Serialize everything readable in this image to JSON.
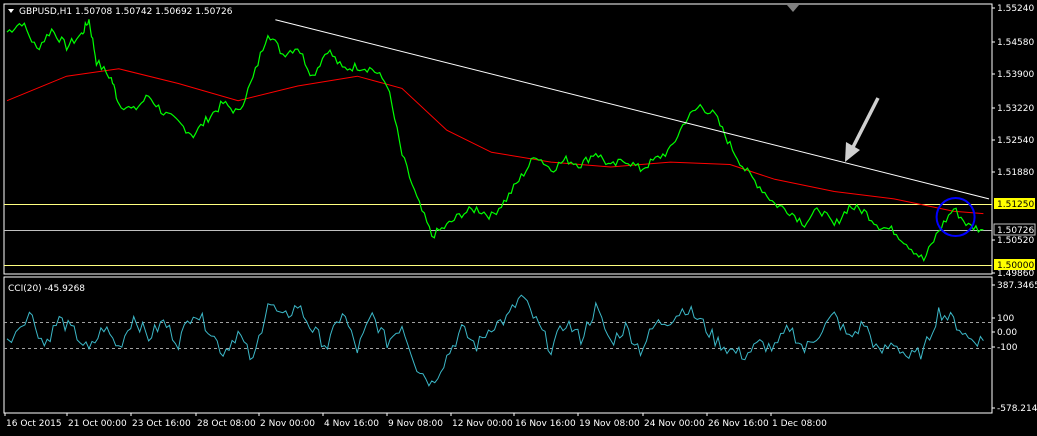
{
  "header": {
    "symbol": "GBPUSD,H1",
    "ohlc": "1.50708 1.50742 1.50692 1.50726"
  },
  "indicator_header": {
    "label": "CCI(20) -45.9268"
  },
  "colors": {
    "background": "#000000",
    "price_line": "#00ff00",
    "moving_average": "#ff0000",
    "trendline": "#ffffff",
    "horizontal_level": "#ffff80",
    "current_price_line": "#c0c0c0",
    "highlight_circle": "#0000ff",
    "cci_line": "#3cb8c8",
    "cci_level_line": "#a0a0a0",
    "frame": "#ffffff",
    "label_yellow_bg": "#ffff00"
  },
  "icons": [
    "dropdown-triangle-icon",
    "arrow-down-left-icon",
    "scroll-marker-icon"
  ],
  "chart_data": [
    {
      "type": "line",
      "panel": "price",
      "x_labels": [
        "16 Oct 2015",
        "21 Oct 00:00",
        "23 Oct 16:00",
        "28 Oct 08:00",
        "2 Nov 00:00",
        "4 Nov 16:00",
        "9 Nov 08:00",
        "12 Nov 00:00",
        "16 Nov 16:00",
        "19 Nov 08:00",
        "24 Nov 00:00",
        "26 Nov 16:00",
        "1 Dec 08:00"
      ],
      "y_ticks": [
        "1.55240",
        "1.54580",
        "1.53900",
        "1.53220",
        "1.52540",
        "1.51880",
        "1.50520",
        "1.49860"
      ],
      "ylim": [
        1.4982,
        1.5532
      ],
      "grid": false,
      "price_path": [
        [
          0,
          1.5475
        ],
        [
          2,
          1.5495
        ],
        [
          4,
          1.544
        ],
        [
          6,
          1.548
        ],
        [
          8,
          1.5445
        ],
        [
          10,
          1.547
        ],
        [
          11,
          1.55
        ],
        [
          12,
          1.5415
        ],
        [
          14,
          1.538
        ],
        [
          15,
          1.533
        ],
        [
          17,
          1.5315
        ],
        [
          19,
          1.5345
        ],
        [
          21,
          1.531
        ],
        [
          23,
          1.529
        ],
        [
          25,
          1.5265
        ],
        [
          27,
          1.53
        ],
        [
          29,
          1.533
        ],
        [
          31,
          1.531
        ],
        [
          33,
          1.538
        ],
        [
          35,
          1.5475
        ],
        [
          37,
          1.543
        ],
        [
          39,
          1.5445
        ],
        [
          41,
          1.5385
        ],
        [
          43,
          1.544
        ],
        [
          45,
          1.54
        ],
        [
          47,
          1.5405
        ],
        [
          49,
          1.54
        ],
        [
          51,
          1.537
        ],
        [
          53,
          1.5225
        ],
        [
          55,
          1.5135
        ],
        [
          57,
          1.506
        ],
        [
          59,
          1.508
        ],
        [
          61,
          1.5105
        ],
        [
          63,
          1.5115
        ],
        [
          65,
          1.51
        ],
        [
          67,
          1.5135
        ],
        [
          69,
          1.518
        ],
        [
          71,
          1.5225
        ],
        [
          73,
          1.5195
        ],
        [
          75,
          1.5215
        ],
        [
          77,
          1.5205
        ],
        [
          79,
          1.523
        ],
        [
          81,
          1.52
        ],
        [
          83,
          1.5215
        ],
        [
          85,
          1.5195
        ],
        [
          87,
          1.5215
        ],
        [
          89,
          1.5235
        ],
        [
          91,
          1.5295
        ],
        [
          93,
          1.5325
        ],
        [
          95,
          1.5305
        ],
        [
          97,
          1.5245
        ],
        [
          99,
          1.5195
        ],
        [
          101,
          1.516
        ],
        [
          103,
          1.5125
        ],
        [
          105,
          1.511
        ],
        [
          107,
          1.5085
        ],
        [
          109,
          1.5115
        ],
        [
          111,
          1.508
        ],
        [
          113,
          1.512
        ],
        [
          115,
          1.511
        ],
        [
          117,
          1.508
        ],
        [
          119,
          1.507
        ],
        [
          121,
          1.504
        ],
        [
          123,
          1.501
        ],
        [
          125,
          1.507
        ],
        [
          127,
          1.5115
        ],
        [
          129,
          1.508
        ],
        [
          131,
          1.5072
        ]
      ],
      "moving_average_path": [
        [
          0,
          1.5335
        ],
        [
          8,
          1.5385
        ],
        [
          15,
          1.54
        ],
        [
          23,
          1.537
        ],
        [
          31,
          1.5335
        ],
        [
          39,
          1.5365
        ],
        [
          47,
          1.5385
        ],
        [
          53,
          1.536
        ],
        [
          59,
          1.5275
        ],
        [
          65,
          1.523
        ],
        [
          73,
          1.521
        ],
        [
          81,
          1.52
        ],
        [
          89,
          1.521
        ],
        [
          97,
          1.5205
        ],
        [
          103,
          1.5175
        ],
        [
          111,
          1.515
        ],
        [
          119,
          1.5135
        ],
        [
          127,
          1.511
        ],
        [
          131,
          1.5105
        ]
      ],
      "trendline": [
        [
          44,
          1.55
        ],
        [
          161,
          1.5135
        ]
      ],
      "horizontal_levels": [
        {
          "value": 1.5125,
          "label": "1.51250"
        },
        {
          "value": 1.50726,
          "label": "1.50726"
        },
        {
          "value": 1.5,
          "label": "1.50000"
        }
      ]
    },
    {
      "type": "line",
      "panel": "indicator",
      "y_ticks": [
        "387.3465",
        "100",
        "0.00",
        "-100",
        "-578.214"
      ],
      "ylim": [
        -578.214,
        387.3465
      ],
      "levels": [
        100,
        0,
        -100
      ],
      "cci_path": [
        [
          0,
          -60
        ],
        [
          3,
          180
        ],
        [
          5,
          -80
        ],
        [
          7,
          120
        ],
        [
          9,
          20
        ],
        [
          11,
          -130
        ],
        [
          13,
          60
        ],
        [
          15,
          -100
        ],
        [
          17,
          140
        ],
        [
          19,
          -20
        ],
        [
          21,
          100
        ],
        [
          23,
          -60
        ],
        [
          25,
          190
        ],
        [
          27,
          60
        ],
        [
          29,
          -140
        ],
        [
          31,
          20
        ],
        [
          33,
          -220
        ],
        [
          35,
          260
        ],
        [
          37,
          120
        ],
        [
          39,
          230
        ],
        [
          41,
          40
        ],
        [
          43,
          -90
        ],
        [
          45,
          180
        ],
        [
          47,
          -120
        ],
        [
          49,
          150
        ],
        [
          51,
          -60
        ],
        [
          53,
          80
        ],
        [
          55,
          -250
        ],
        [
          57,
          -380
        ],
        [
          59,
          -170
        ],
        [
          61,
          40
        ],
        [
          63,
          -90
        ],
        [
          65,
          70
        ],
        [
          67,
          120
        ],
        [
          69,
          300
        ],
        [
          71,
          100
        ],
        [
          73,
          -110
        ],
        [
          75,
          100
        ],
        [
          77,
          -30
        ],
        [
          79,
          210
        ],
        [
          81,
          -60
        ],
        [
          83,
          60
        ],
        [
          85,
          -120
        ],
        [
          87,
          80
        ],
        [
          89,
          120
        ],
        [
          91,
          210
        ],
        [
          93,
          110
        ],
        [
          95,
          -40
        ],
        [
          97,
          -120
        ],
        [
          99,
          -160
        ],
        [
          101,
          -70
        ],
        [
          103,
          -110
        ],
        [
          105,
          60
        ],
        [
          107,
          -120
        ],
        [
          109,
          20
        ],
        [
          111,
          150
        ],
        [
          113,
          -30
        ],
        [
          115,
          90
        ],
        [
          117,
          -150
        ],
        [
          119,
          -60
        ],
        [
          121,
          -180
        ],
        [
          123,
          -130
        ],
        [
          125,
          180
        ],
        [
          127,
          110
        ],
        [
          129,
          -30
        ],
        [
          131,
          -46
        ]
      ]
    }
  ]
}
